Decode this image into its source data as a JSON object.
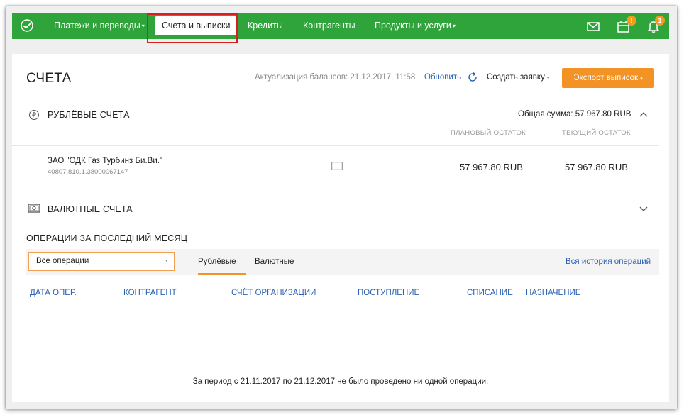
{
  "nav": {
    "items": [
      {
        "label": "Платежи и переводы",
        "has_caret": true
      },
      {
        "label": "Счета и выписки",
        "active": true
      },
      {
        "label": "Кредиты"
      },
      {
        "label": "Контрагенты"
      },
      {
        "label": "Продукты и услуги",
        "has_caret": true
      }
    ],
    "icons": [
      "mail-icon",
      "calendar-icon",
      "bell-icon"
    ],
    "badges": {
      "calendar": "!",
      "bell": "1"
    },
    "caret": "▾"
  },
  "page": {
    "title": "СЧЕТА",
    "refresh_info": "Актуализация балансов: 21.12.2017, 11:58",
    "refresh_link": "Обновить",
    "create_request": "Создать заявку",
    "export_button": "Экспорт выписок"
  },
  "ruble_accounts": {
    "heading": "РУБЛЁВЫЕ СЧЕТА",
    "total": "Общая сумма: 57 967.80 RUB",
    "col_planned": "ПЛАНОВЫЙ ОСТАТОК",
    "col_current": "ТЕКУЩИЙ ОСТАТОК",
    "rows": [
      {
        "name": "ЗАО \"ОДК Газ Турбинз Би.Ви.\"",
        "number": "40807.810.1.38000067147",
        "planned": "57 967.80 RUB",
        "current": "57 967.80 RUB"
      }
    ]
  },
  "currency_accounts": {
    "heading": "ВАЛЮТНЫЕ СЧЕТА"
  },
  "operations": {
    "heading": "ОПЕРАЦИИ ЗА ПОСЛЕДНИЙ МЕСЯЦ",
    "filter_value": "Все операции",
    "tabs": [
      "Рублёвые",
      "Валютные"
    ],
    "active_tab": "Рублёвые",
    "history_link": "Вся история операций",
    "columns": [
      "ДАТА ОПЕР.",
      "КОНТРАГЕНТ",
      "СЧЁТ ОРГАНИЗАЦИИ",
      "ПОСТУПЛЕНИЕ",
      "СПИСАНИЕ",
      "НАЗНАЧЕНИЕ"
    ],
    "empty_message": "За период с 21.11.2017 по 21.12.2017 не было проведено ни одной операции."
  },
  "colors": {
    "brand_green": "#2ea43a",
    "accent_orange": "#f39325",
    "link_blue": "#2a62b5",
    "highlight_red": "#d61f1f"
  }
}
